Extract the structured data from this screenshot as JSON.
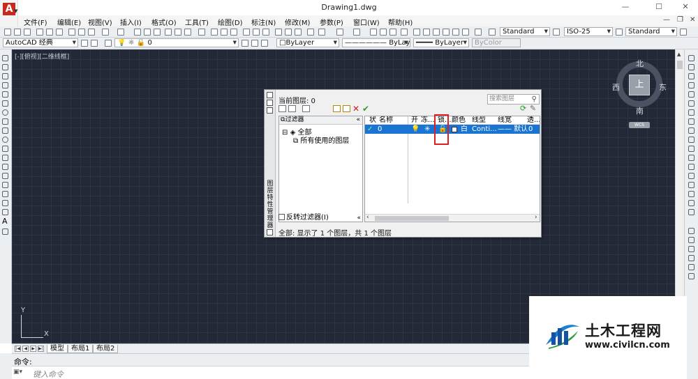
{
  "window": {
    "title": "Drawing1.dwg"
  },
  "menubar": [
    "文件(F)",
    "编辑(E)",
    "视图(V)",
    "插入(I)",
    "格式(O)",
    "工具(T)",
    "绘图(D)",
    "标注(N)",
    "修改(M)",
    "参数(P)",
    "窗口(W)",
    "帮助(H)"
  ],
  "toolbar": {
    "text_style": "Standard",
    "dim_style": "ISO-25",
    "table_style": "Standard",
    "workspace": "AutoCAD 经典",
    "layer_current": "0",
    "color": "ByLayer",
    "linetype": "ByLayer",
    "lineweight": "ByLayer",
    "plot_style": "ByColor"
  },
  "viewport": {
    "label": "[-][俯视][二维线框]"
  },
  "viewcube": {
    "north": "北",
    "south": "南",
    "east": "东",
    "west": "西",
    "face": "上",
    "wcs": "WCS"
  },
  "ucs": {
    "x": "X",
    "y": "Y"
  },
  "layout_tabs": [
    "模型",
    "布局1",
    "布局2"
  ],
  "command": {
    "history_label": "命令:",
    "prompt_placeholder": "键入命令"
  },
  "layer_dialog": {
    "side_title": "图层特性管理器",
    "current_layer": "当前图层: 0",
    "search_placeholder": "搜索图层",
    "filter_header": "过滤器",
    "tree_all": "全部",
    "tree_used": "所有使用的图层",
    "invert_filter": "反转过滤器(I)",
    "columns": [
      "状",
      "名称",
      "开",
      "冻...",
      "锁...",
      "颜色",
      "线型",
      "线宽",
      "透..."
    ],
    "rows": [
      {
        "status": "✓",
        "name": "0",
        "color": "白",
        "linetype": "Conti...",
        "lineweight": "—— 默认",
        "transparency": "0"
      }
    ],
    "status_bar": "全部: 显示了 1 个图层，共 1 个图层"
  },
  "watermark": {
    "brand": "土木工程网",
    "url": "www.civilcn.com"
  }
}
